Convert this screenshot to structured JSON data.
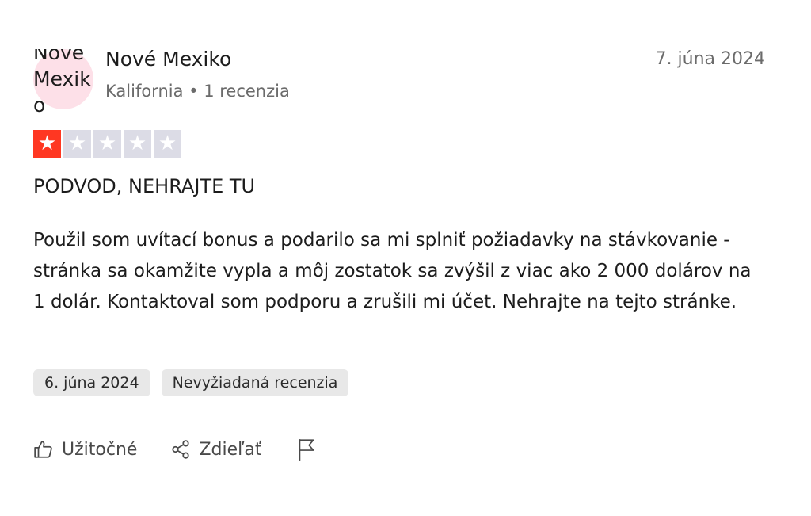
{
  "reviewer": {
    "avatar_text": "Nové Mexiko",
    "name": "Nové Mexiko",
    "meta": "Kalifornia • 1 recenzia"
  },
  "review": {
    "date": "7. júna 2024",
    "rating": 1,
    "rating_max": 5,
    "title": "PODVOD, NEHRAJTE TU",
    "body": "Použil som uvítací bonus a podarilo sa mi splniť požiadavky na stávkovanie - stránka sa okamžite vypla a môj zostatok sa zvýšil z viac ako 2 000 dolárov na 1 dolár. Kontaktoval som podporu a zrušili mi účet. Nehrajte na tejto stránke.",
    "experience_date": "6. júna 2024",
    "source_tag": "Nevyžiadaná recenzia"
  },
  "actions": {
    "useful_label": "Užitočné",
    "share_label": "Zdieľať",
    "useful_icon": "thumbs-up-icon",
    "share_icon": "share-icon",
    "report_icon": "flag-icon"
  },
  "colors": {
    "star_on": "#ff3722",
    "star_off": "#dcdce6",
    "avatar_bg": "#fde0e8"
  }
}
